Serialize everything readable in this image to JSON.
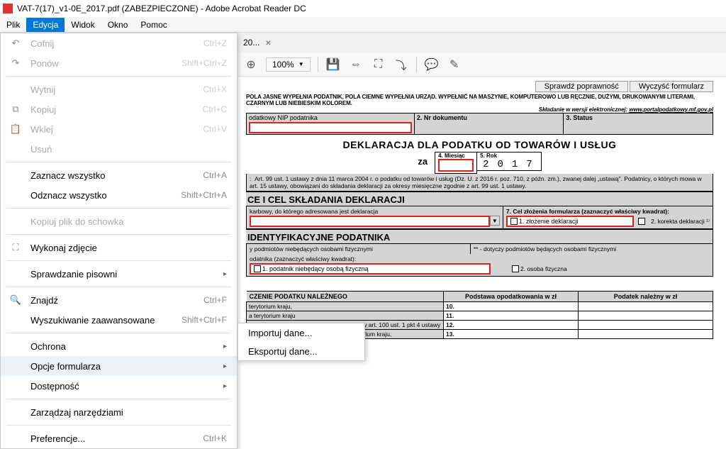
{
  "window": {
    "title": "VAT-7(17)_v1-0E_2017.pdf (ZABEZPIECZONE) - Adobe Acrobat Reader DC"
  },
  "menubar": [
    "Plik",
    "Edycja",
    "Widok",
    "Okno",
    "Pomoc"
  ],
  "tab": {
    "label_suffix": "20...",
    "close": "×"
  },
  "toolbar": {
    "zoom": "100%"
  },
  "edit_menu": {
    "undo": "Cofnij",
    "undo_sc": "Ctrl+Z",
    "redo": "Ponów",
    "redo_sc": "Shift+Ctrl+Z",
    "cut": "Wytnij",
    "cut_sc": "Ctrl+X",
    "copy": "Kopiuj",
    "copy_sc": "Ctrl+C",
    "paste": "Wklej",
    "paste_sc": "Ctrl+V",
    "delete": "Usuń",
    "selall": "Zaznacz wszystko",
    "selall_sc": "Ctrl+A",
    "desel": "Odznacz wszystko",
    "desel_sc": "Shift+Ctrl+A",
    "copyfile": "Kopiuj plik do schowka",
    "snapshot": "Wykonaj zdjęcie",
    "spell": "Sprawdzanie pisowni",
    "find": "Znajdź",
    "find_sc": "Ctrl+F",
    "advfind": "Wyszukiwanie zaawansowane",
    "advfind_sc": "Shift+Ctrl+F",
    "protect": "Ochrona",
    "formopts": "Opcje formularza",
    "access": "Dostępność",
    "tools": "Zarządzaj narzędziami",
    "prefs": "Preferencje...",
    "prefs_sc": "Ctrl+K"
  },
  "submenu": {
    "import": "Importuj dane...",
    "export": "Eksportuj dane..."
  },
  "form": {
    "check_btn": "Sprawdź poprawność",
    "clear_btn": "Wyczyść formularz",
    "instr1": "POLA JASNE WYPEŁNIA PODATNIK, POLA CIEMNE WYPEŁNIA URZĄD. WYPEŁNIĆ NA MASZYNIE, KOMPUTEROWO LUB RĘCZNIE, DUŻYMI, DRUKOWANYMI LITERAMI, CZARNYM LUB NIEBIESKIM KOLOREM.",
    "instr2a": "Składanie w wersji elektronicznej: ",
    "instr2b": "www.portalpodatkowy.mf.gov.pl",
    "nip_label": "odatkowy NIP podatnika",
    "nr_label": "2. Nr dokumentu",
    "status_label": "3. Status",
    "decl_title": "DEKLARACJA DLA PODATKU OD TOWARÓW I USŁUG",
    "za": "za",
    "month_label": "4. Miesiąc",
    "year_label": "5. Rok",
    "year_value": "2017",
    "note_prefix": ":",
    "note": "Art. 99 ust. 1 ustawy z dnia 11 marca 2004 r. o podatku od towarów i usług (Dz. U. z 2016 r. poz. 710, z późn. zm.), zwanej dalej „ustawą\". Podatnicy, o których mowa w art. 15 ustawy, obowiązani do składania deklaracji za okresy miesięczne zgodnie z art. 99 ust. 1 ustawy.",
    "secA": "CE I CEL SKŁADANIA DEKLARACJI",
    "office_label": "karbowy, do którego adresowana jest deklaracja",
    "purpose_label": "7. Cel złożenia formularza (zaznaczyć właściwy kwadrat):",
    "purpose1": "1. złożenie deklaracji",
    "purpose2": "2. korekta deklaracji ¹⁾",
    "secB": "IDENTYFIKACYJNE PODATNIKA",
    "secB_sub": "y podmiotów niebędących osobami fizycznymi",
    "secB_sub2": "** - dotyczy podmiotów będących osobami fizycznymi",
    "taxpayer_label": "odatnika (zaznaczyć właściwy kwadrat):",
    "tp1": "1. podatnik niebędący osobą fizyczną",
    "tp2": "2. osoba fizyczna",
    "secC": "CZENIE PODATKU NALEŻNEGO",
    "col1": "Podstawa opodatkowania w zł",
    "col2": "Podatek należny  w zł",
    "r10": "terytorium kraju,",
    "n10": "10.",
    "r11": "a terytorium kraju",
    "n11": "11.",
    "r12": "w tym świadczenie usług, o których mowa w art. 100 ust. 1 pkt 4 ustawy",
    "n12": "12.",
    "r13": "i towarów oraz świadczenie usług na terytorium kraju,",
    "n13": "13."
  }
}
